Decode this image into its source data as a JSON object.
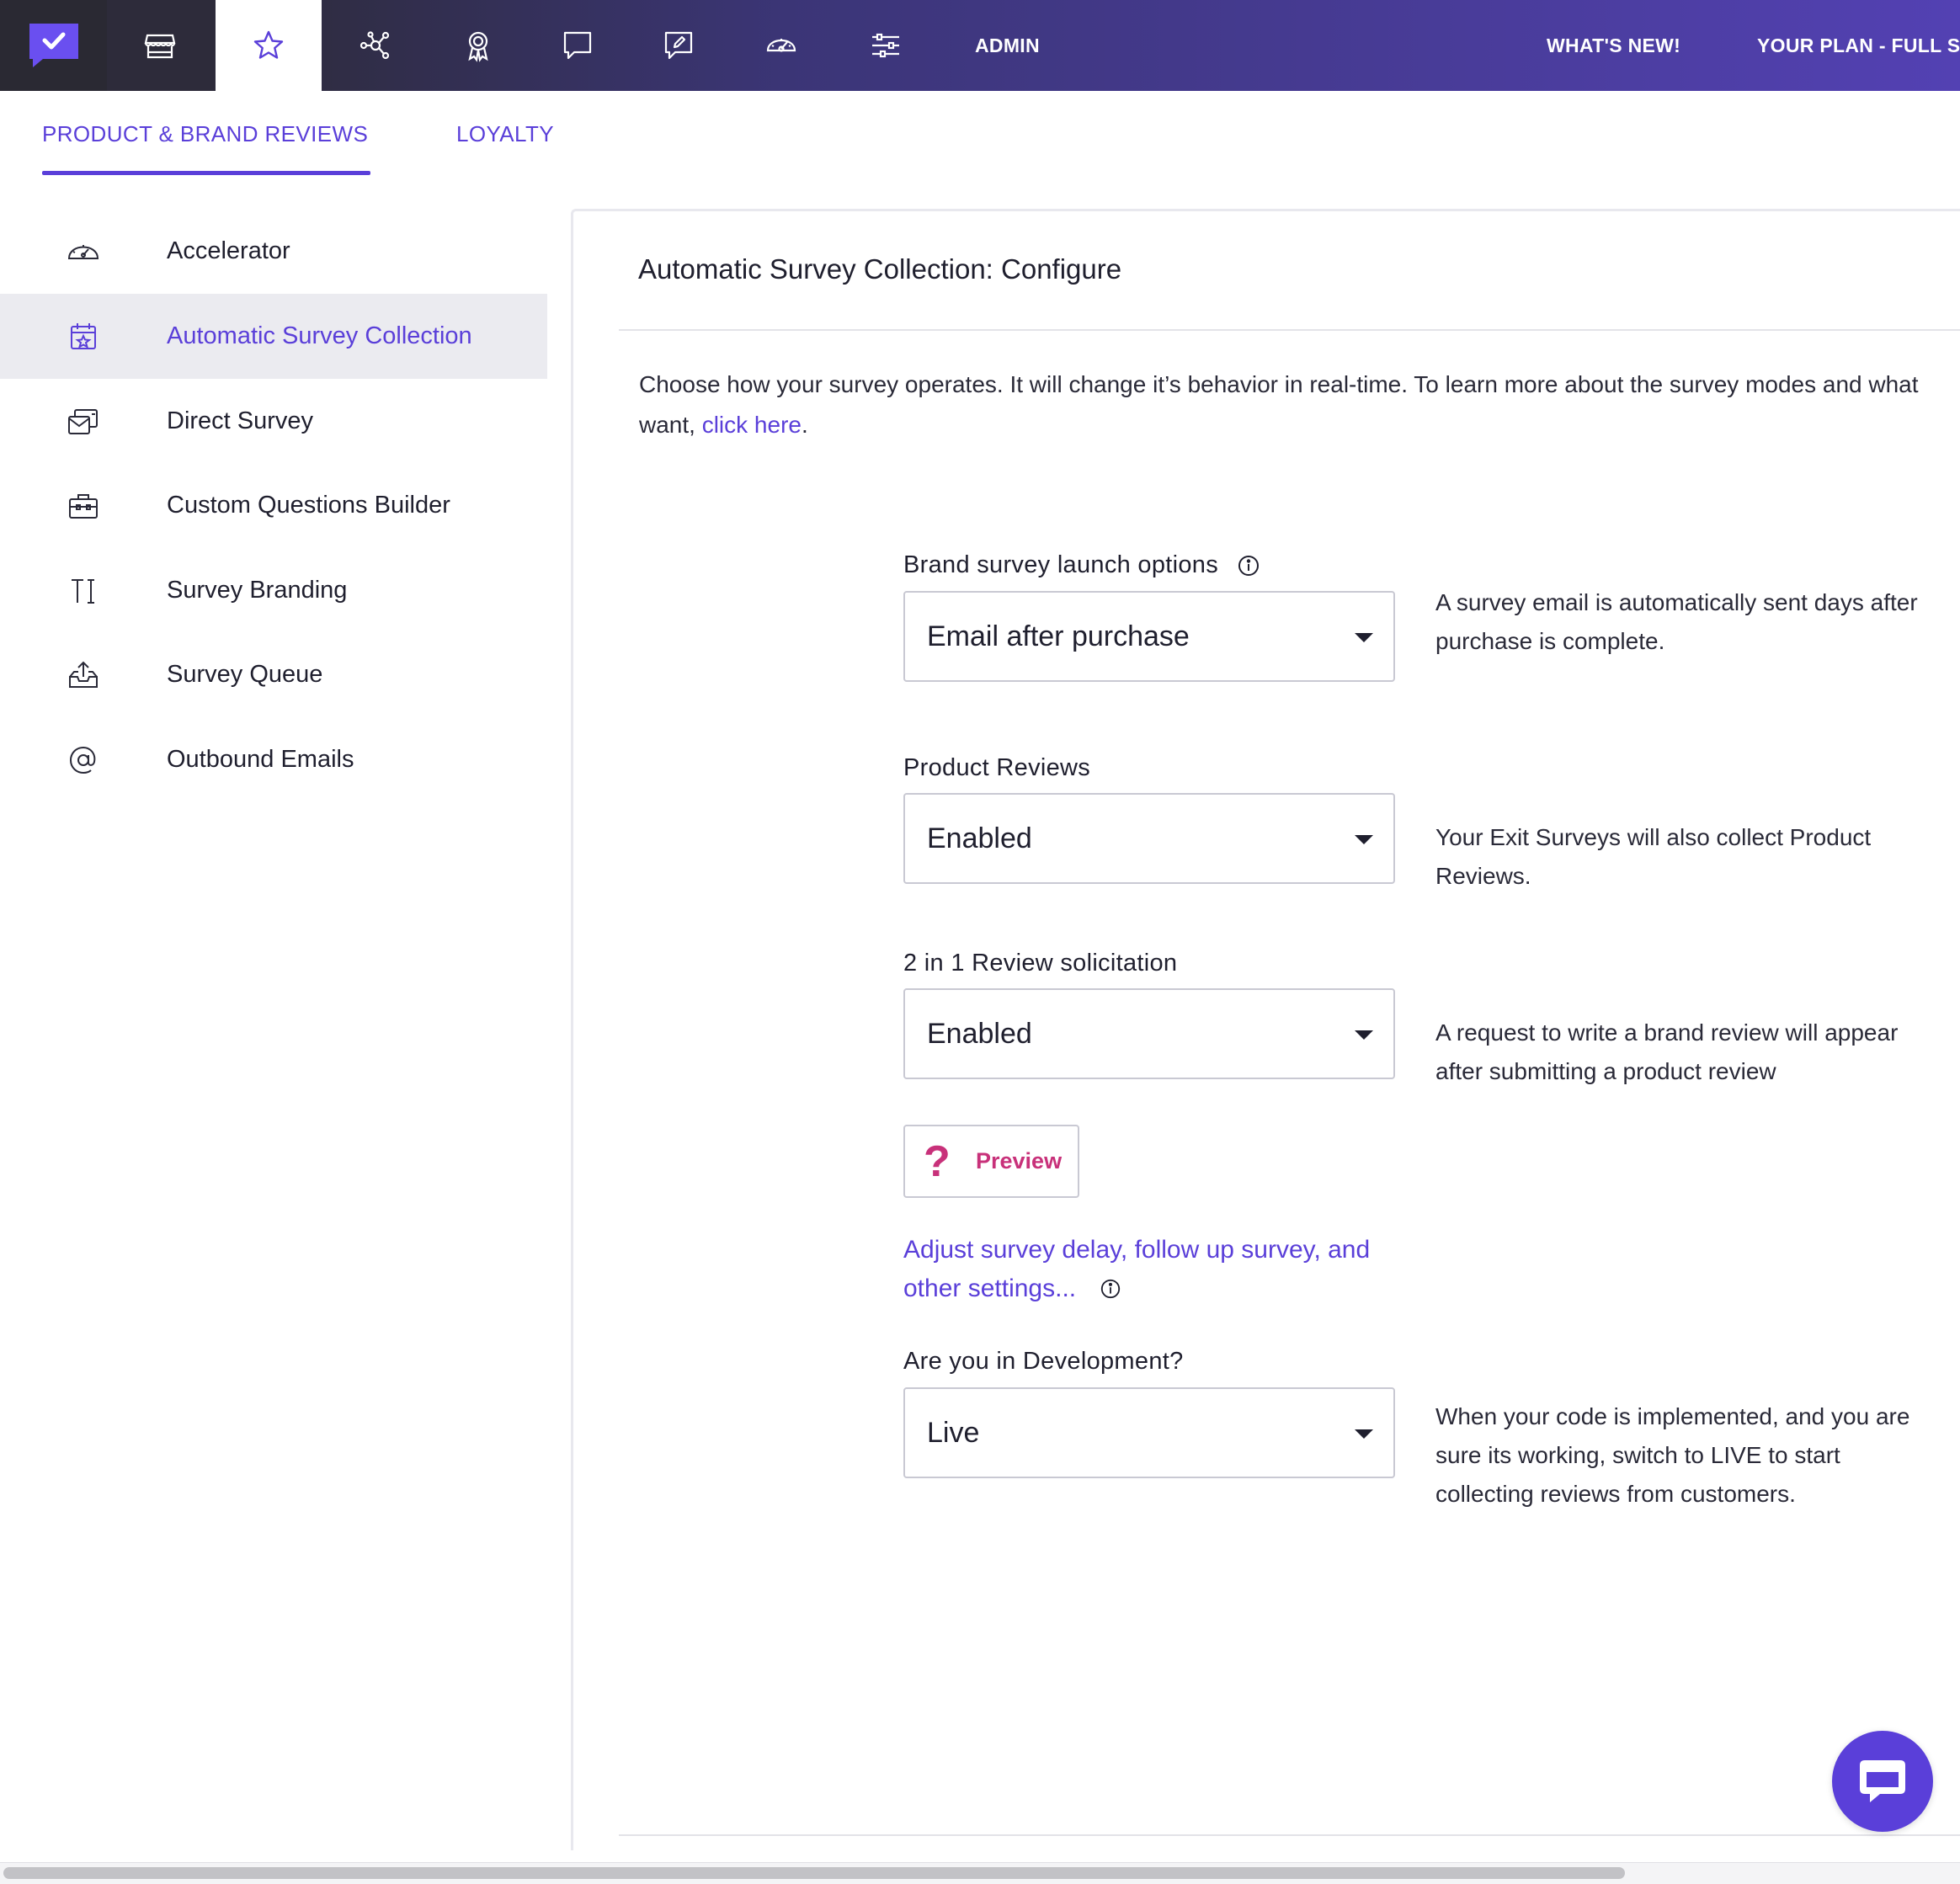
{
  "nav": {
    "admin_label": "ADMIN",
    "whats_new_label": "WHAT'S NEW!",
    "plan_label": "YOUR PLAN - FULL SU",
    "icons": [
      "app-logo-icon",
      "store-icon",
      "star-icon",
      "network-icon",
      "award-icon",
      "chat-icon",
      "edit-message-icon",
      "gauge-icon",
      "sliders-icon"
    ],
    "active_icon": "star-icon"
  },
  "tabs": {
    "items": [
      {
        "label": "PRODUCT & BRAND REVIEWS",
        "active": true
      },
      {
        "label": "LOYALTY",
        "active": false
      }
    ]
  },
  "sidebar": {
    "items": [
      {
        "label": "Accelerator",
        "icon": "gauge-icon"
      },
      {
        "label": "Automatic Survey Collection",
        "icon": "calendar-star-icon",
        "active": true
      },
      {
        "label": "Direct Survey",
        "icon": "mail-card-icon"
      },
      {
        "label": "Custom Questions Builder",
        "icon": "toolbox-icon"
      },
      {
        "label": "Survey Branding",
        "icon": "text-cursor-icon"
      },
      {
        "label": "Survey Queue",
        "icon": "inbox-upload-icon"
      },
      {
        "label": "Outbound Emails",
        "icon": "at-sign-icon"
      }
    ]
  },
  "main": {
    "title": "Automatic Survey Collection: Configure",
    "intro_text": "Choose how your survey operates. It will change it’s behavior in real-time. To learn more about the survey modes and what",
    "intro_text_2": "want, ",
    "intro_link": "click here",
    "intro_end": ".",
    "fields": [
      {
        "label": "Brand survey launch options",
        "value": "Email after purchase",
        "help": "A survey email is automatically sent days after purchase is complete."
      },
      {
        "label": "Product Reviews",
        "value": "Enabled",
        "help": "Your Exit Surveys will also collect Product Reviews."
      },
      {
        "label": "2 in 1 Review solicitation",
        "value": "Enabled",
        "help": "A request to write a brand review will appear after submitting a product review"
      },
      {
        "label": "Are you in Development?",
        "value": "Live",
        "help": "When your code is implemented, and you are sure its working, switch to LIVE to start collecting reviews from customers."
      }
    ],
    "preview_glyph": "?",
    "preview_label": "Preview",
    "adjust_link": "Adjust survey delay, follow up survey, and other settings..."
  },
  "colors": {
    "accent": "#5a3fd9",
    "preview": "#c8317a",
    "nav_dark": "#2d2b3a",
    "nav_purple": "#5341b3",
    "sidebar_active_bg": "#ebebf0"
  }
}
